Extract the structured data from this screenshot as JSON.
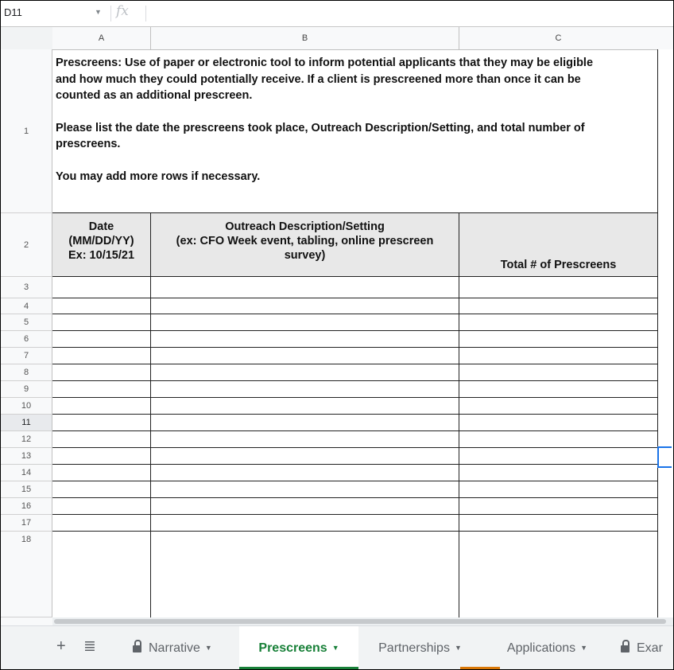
{
  "formula_bar": {
    "cell_ref": "D11",
    "fx": "fx",
    "formula": ""
  },
  "columns": [
    "A",
    "B",
    "C"
  ],
  "rows": [
    "1",
    "2",
    "3",
    "4",
    "5",
    "6",
    "7",
    "8",
    "9",
    "10",
    "11",
    "12",
    "13",
    "14",
    "15",
    "16",
    "17",
    "18"
  ],
  "active_row": "11",
  "instructions": {
    "line1": "Prescreens: Use of paper or electronic tool to inform potential applicants that they may be eligible",
    "line2": "and how much they could potentially receive. If a client is prescreened more than once it can be",
    "line3": "counted as an additional prescreen.",
    "line4": "Please list the date the prescreens took place, Outreach Description/Setting, and total number of",
    "line5": "prescreens.",
    "line6": "You may add more rows if necessary."
  },
  "table_header": {
    "date_line1": "Date",
    "date_line2": "(MM/DD/YY)",
    "date_line3": "Ex: 10/15/21",
    "outreach_line1": "Outreach Description/Setting",
    "outreach_line2": "(ex: CFO Week event, tabling, online prescreen",
    "outreach_line3": "survey)",
    "total": "Total # of Prescreens"
  },
  "tabs": [
    {
      "label": "Narrative",
      "locked": true,
      "active": false
    },
    {
      "label": "Prescreens",
      "locked": false,
      "active": true
    },
    {
      "label": "Partnerships",
      "locked": false,
      "active": false
    },
    {
      "label": "Applications",
      "locked": false,
      "active": false
    },
    {
      "label": "Exar",
      "locked": true,
      "active": false
    }
  ],
  "colors": {
    "active_tab": "#188038",
    "selection": "#1a73e8",
    "tab_underline_orange": "#d97706"
  }
}
